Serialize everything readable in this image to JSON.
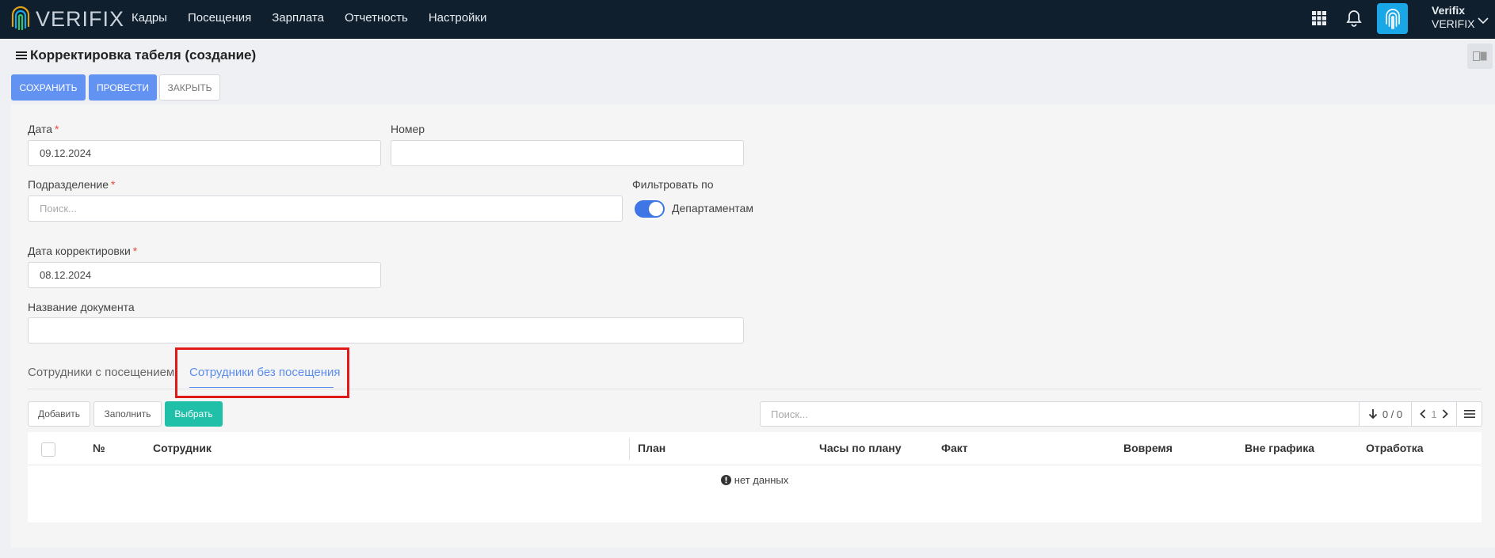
{
  "brand": {
    "logo_text": "VERIFIX"
  },
  "nav": [
    {
      "label": "Кадры"
    },
    {
      "label": "Посещения"
    },
    {
      "label": "Зарплата"
    },
    {
      "label": "Отчетность"
    },
    {
      "label": "Настройки"
    }
  ],
  "user": {
    "name": "Verifix",
    "org": "VERIFIX"
  },
  "page": {
    "title": "Корректировка табеля (создание)"
  },
  "actions": {
    "save": "СОХРАНИТЬ",
    "post": "ПРОВЕСТИ",
    "close": "ЗАКРЫТЬ"
  },
  "form": {
    "date_label": "Дата",
    "date_value": "09.12.2024",
    "number_label": "Номер",
    "number_value": "",
    "division_label": "Подразделение",
    "division_placeholder": "Поиск...",
    "filter_label": "Фильтровать по",
    "filter_toggle_label": "Департаментам",
    "filter_toggle_on": true,
    "correction_date_label": "Дата корректировки",
    "correction_date_value": "08.12.2024",
    "doc_name_label": "Название документа",
    "doc_name_value": "",
    "required_mark": "*"
  },
  "tabs": [
    {
      "label": "Сотрудники с посещением",
      "active": false
    },
    {
      "label": "Сотрудники без посещения",
      "active": true
    }
  ],
  "table_toolbar": {
    "add": "Добавить",
    "fill": "Заполнить",
    "select": "Выбрать",
    "search_placeholder": "Поиск...",
    "count": "0 / 0",
    "page": "1"
  },
  "table": {
    "columns": [
      "№",
      "Сотрудник",
      "План",
      "Часы по плану",
      "Факт",
      "Вовремя",
      "Вне графика",
      "Отработка"
    ],
    "rows": [],
    "empty_text": "нет данных"
  },
  "colors": {
    "navbar": "#0f1f2e",
    "primary": "#6393f2",
    "teal": "#1fbfa8",
    "accent": "#1aa7e8",
    "highlight": "#e01919"
  }
}
